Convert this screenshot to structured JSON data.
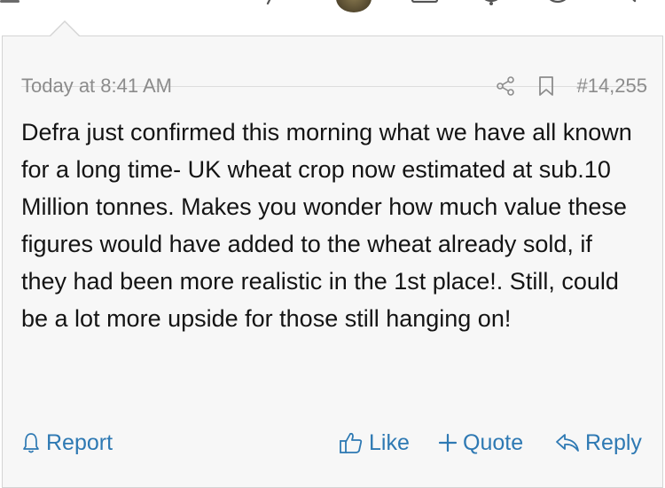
{
  "post": {
    "timestamp": "Today at 8:41 AM",
    "post_number": "#14,255",
    "body": "Defra just confirmed this morning what we have all known for a long time- UK wheat crop now estimated at sub.10 Million tonnes. Makes you wonder how much value these figures would have added to the wheat already sold, if they had been more realistic in the 1st place!. Still, could be a lot more upside for those still hanging on!"
  },
  "actions": {
    "report": "Report",
    "like": "Like",
    "quote": "Quote",
    "reply": "Reply"
  },
  "colors": {
    "link": "#2e79b3",
    "meta_text": "#8c8c8c",
    "body_text": "#141414",
    "card_bg": "#f7f7f7"
  },
  "icons": {
    "top": [
      "menu-icon",
      "pen-icon",
      "avatar",
      "inbox-icon",
      "alerts-icon",
      "account-icon",
      "search-icon"
    ],
    "meta": [
      "share-icon",
      "bookmark-icon"
    ],
    "actions": [
      "flag-icon",
      "thumbs-up-icon",
      "plus-icon",
      "reply-arrow-icon"
    ]
  }
}
